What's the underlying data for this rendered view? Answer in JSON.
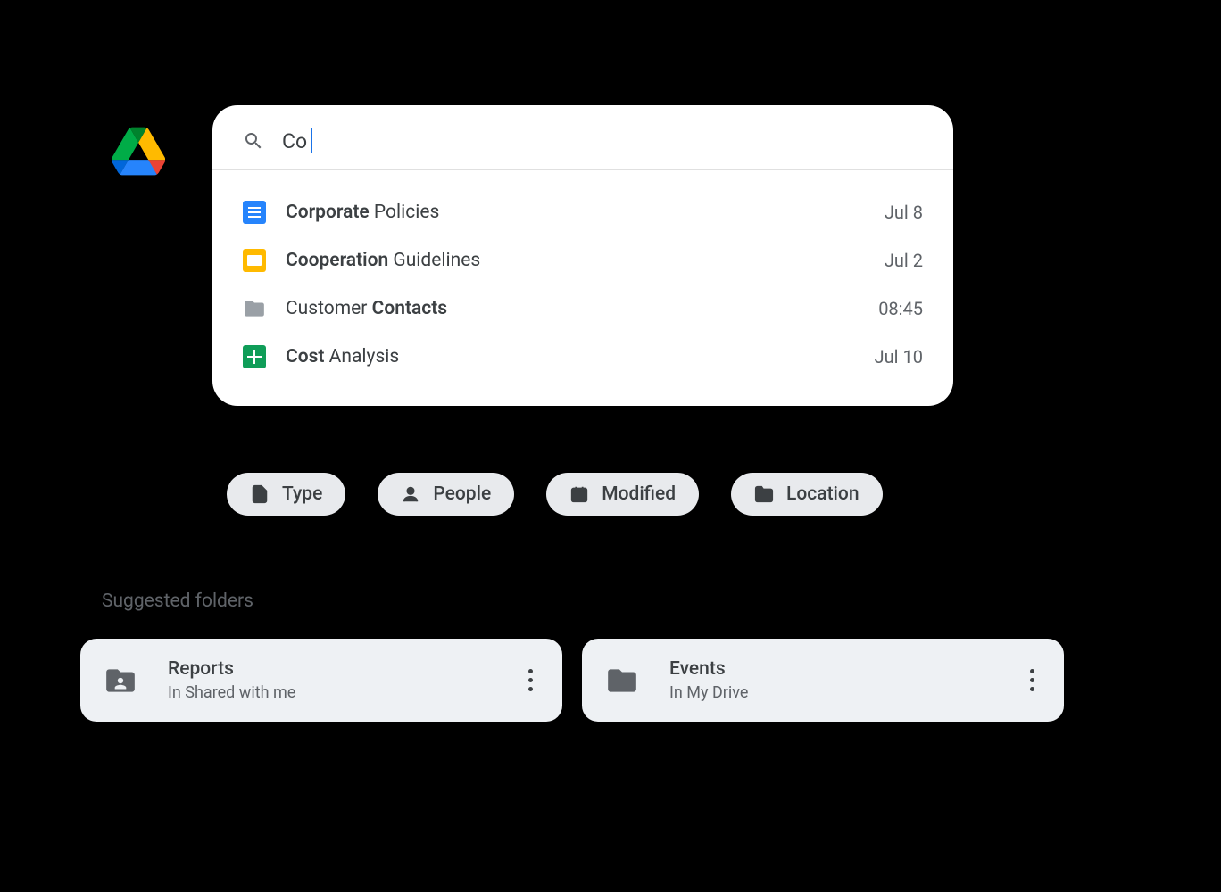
{
  "search": {
    "query": "Co"
  },
  "results": [
    {
      "name_bold": "Corporate",
      "name_rest": " Policies",
      "date": "Jul 8",
      "type": "doc"
    },
    {
      "name_bold": "Cooperation",
      "name_rest": " Guidelines",
      "date": "Jul 2",
      "type": "slides"
    },
    {
      "name_prefix": "Customer ",
      "name_bold": "Contacts",
      "date": "08:45",
      "type": "folder"
    },
    {
      "name_bold": "Cost",
      "name_rest": " Analysis",
      "date": "Jul 10",
      "type": "sheets"
    }
  ],
  "chips": [
    {
      "label": "Type"
    },
    {
      "label": "People"
    },
    {
      "label": "Modified"
    },
    {
      "label": "Location"
    }
  ],
  "suggested_heading": "Suggested folders",
  "folders": [
    {
      "name": "Reports",
      "location": "In Shared with me",
      "shared": true
    },
    {
      "name": "Events",
      "location": "In My Drive",
      "shared": false
    }
  ]
}
